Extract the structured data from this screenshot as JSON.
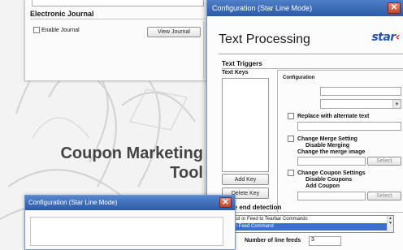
{
  "headline": {
    "line1": "Coupon Marketing",
    "line2": "Tool"
  },
  "journal_window": {
    "section_title": "Electronic Journal",
    "enable_label": "Enable Journal",
    "view_button": "View Journal"
  },
  "main_window": {
    "title": "Configuration (Star Line Mode)",
    "close_glyph": "✕",
    "heading": "Text Processing",
    "brand": {
      "text": "star",
      "mark": "‹"
    },
    "text_triggers_title": "Text Triggers",
    "text_keys_label": "Text Keys",
    "configuration_label": "Configuration",
    "replace_label": "Replace with alternate text",
    "merge": {
      "title": "Change Merge Setting",
      "disable": "Disable Merging",
      "change_image": "Change the merge image",
      "select_button": "Select"
    },
    "coupon": {
      "title": "Change Coupon Settings",
      "disable": "Disable Coupons",
      "add": "Add Coupon",
      "select_button": "Select"
    },
    "add_key_button": "Add Key",
    "delete_key_button": "Delete Key",
    "page_end_title": "Page end detection",
    "page_end_options": [
      "Cut or Feed to Tearbar Commands",
      "Form Feed Command"
    ],
    "line_feeds_label": "Number of line feeds",
    "line_feeds_value": "3"
  },
  "second_window": {
    "title": "Configuration (Star Line Mode)",
    "close_glyph": "✕"
  },
  "colors": {
    "titlebar": "#2c5aa7",
    "brand_blue": "#2453a8",
    "close_red": "#c2442b",
    "selection": "#3a6fd0"
  }
}
